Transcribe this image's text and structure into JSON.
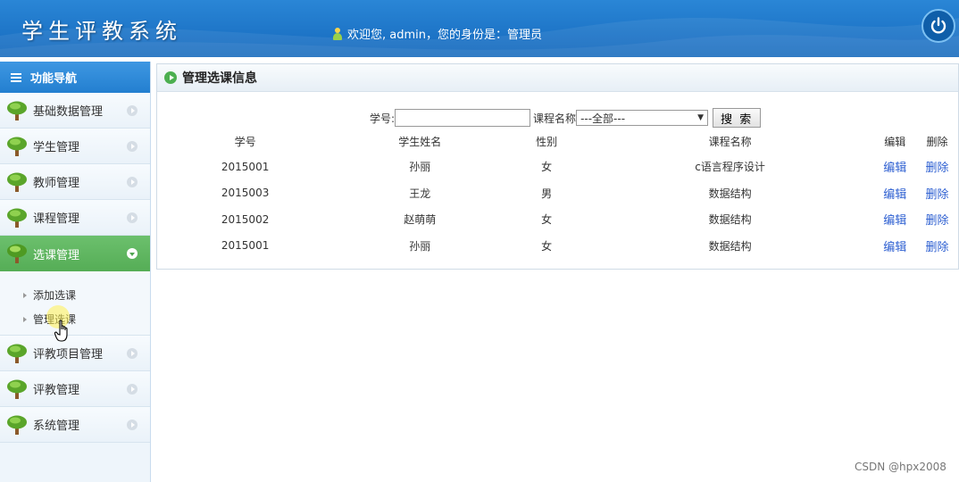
{
  "header": {
    "title": "学生评教系统",
    "welcome": "欢迎您, admin，您的身份是：管理员"
  },
  "sidebar": {
    "title": "功能导航",
    "items": [
      {
        "label": "基础数据管理"
      },
      {
        "label": "学生管理"
      },
      {
        "label": "教师管理"
      },
      {
        "label": "课程管理"
      },
      {
        "label": "选课管理",
        "sub": [
          {
            "label": "添加选课"
          },
          {
            "label": "管理选课"
          }
        ]
      },
      {
        "label": "评教项目管理"
      },
      {
        "label": "评教管理"
      },
      {
        "label": "系统管理"
      }
    ]
  },
  "main": {
    "title": "管理选课信息",
    "search": {
      "id_label": "学号:",
      "id_value": "",
      "course_label": "课程名称",
      "course_selected": "---全部---",
      "button": "搜 索"
    },
    "table": {
      "headers": [
        "学号",
        "学生姓名",
        "性别",
        "课程名称",
        "编辑",
        "删除"
      ],
      "rows": [
        {
          "id": "2015001",
          "name": "孙丽",
          "sex": "女",
          "course": "c语言程序设计",
          "edit": "编辑",
          "del": "删除"
        },
        {
          "id": "2015003",
          "name": "王龙",
          "sex": "男",
          "course": "数据结构",
          "edit": "编辑",
          "del": "删除"
        },
        {
          "id": "2015002",
          "name": "赵萌萌",
          "sex": "女",
          "course": "数据结构",
          "edit": "编辑",
          "del": "删除"
        },
        {
          "id": "2015001",
          "name": "孙丽",
          "sex": "女",
          "course": "数据结构",
          "edit": "编辑",
          "del": "删除"
        }
      ]
    }
  },
  "watermark": "CSDN @hpx2008",
  "colors": {
    "header": "#1a73c9",
    "active_nav": "#5fb660",
    "link": "#2d5fd1"
  }
}
